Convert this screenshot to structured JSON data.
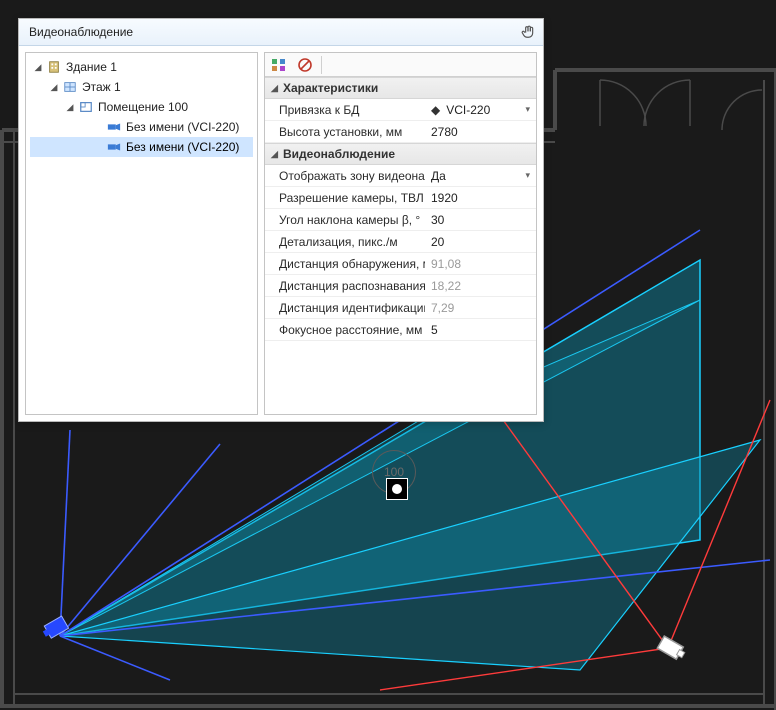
{
  "panel": {
    "title": "Видеонаблюдение"
  },
  "tree": {
    "items": [
      {
        "label": "Здание 1",
        "indent": 0,
        "expanded": true,
        "icon": "building",
        "selected": false
      },
      {
        "label": "Этаж 1",
        "indent": 1,
        "expanded": true,
        "icon": "floor",
        "selected": false
      },
      {
        "label": "Помещение 100",
        "indent": 2,
        "expanded": true,
        "icon": "room",
        "selected": false
      },
      {
        "label": "Без имени (VCI-220)",
        "indent": 3,
        "expanded": null,
        "icon": "camera",
        "selected": false
      },
      {
        "label": "Без имени (VCI-220)",
        "indent": 3,
        "expanded": null,
        "icon": "camera",
        "selected": true
      }
    ]
  },
  "properties": {
    "categories": [
      {
        "title": "Характеристики",
        "rows": [
          {
            "name": "Привязка к БД",
            "value": "VCI-220",
            "diamond": true,
            "chevron": true
          },
          {
            "name": "Высота установки, мм",
            "value": "2780"
          }
        ]
      },
      {
        "title": "Видеонаблюдение",
        "rows": [
          {
            "name": "Отображать зону видеонабл...",
            "value": "Да",
            "chevron": true
          },
          {
            "name": "Разрешение камеры, ТВЛ",
            "value": "1920"
          },
          {
            "name": "Угол наклона камеры β, °",
            "value": "30"
          },
          {
            "name": "Детализация, пикс./м",
            "value": "20"
          },
          {
            "name": "Дистанция обнаружения, м",
            "value": "91,08",
            "dim": true
          },
          {
            "name": "Дистанция распознавания, м",
            "value": "18,22",
            "dim": true
          },
          {
            "name": "Дистанция идентификации, м",
            "value": "7,29",
            "dim": true
          },
          {
            "name": "Фокусное расстояние, мм",
            "value": "5"
          }
        ]
      }
    ]
  },
  "canvas": {
    "room_number": "100",
    "colors": {
      "floorplan": "#4a4a4a",
      "camera_zone_fill": "#0d8aa6",
      "camera_zone_stroke": "#19d0ff",
      "blue_lines": "#3b5bff",
      "red_lines": "#ff3b3b"
    }
  }
}
